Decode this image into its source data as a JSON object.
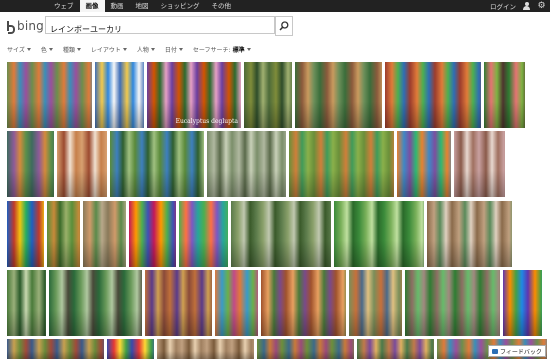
{
  "topnav": {
    "items": [
      "ウェブ",
      "画像",
      "動画",
      "地図",
      "ショッピング",
      "その他"
    ],
    "active_index": 1,
    "login": "ログイン"
  },
  "header": {
    "logo_text": "bing",
    "search_value": "レインボーユーカリ"
  },
  "filters": [
    {
      "label": "サイズ",
      "caret": true
    },
    {
      "label": "色",
      "caret": true
    },
    {
      "label": "種類",
      "caret": true
    },
    {
      "label": "レイアウト",
      "caret": true
    },
    {
      "label": "人物",
      "caret": true
    },
    {
      "label": "日付",
      "caret": true
    },
    {
      "label": "セーフサーチ:",
      "caret": false
    },
    {
      "label": "標準",
      "caret": true,
      "bold": true
    }
  ],
  "image_tiles": [
    {
      "name": "rainbow-eucalyptus-thumb-1",
      "colors": [
        "#6b8e4e",
        "#e07a3a",
        "#3a8fb7",
        "#9a4f9e"
      ]
    },
    {
      "name": "rainbow-eucalyptus-thumb-2",
      "colors": [
        "#3f6fb8",
        "#f2c94c",
        "#2e86de",
        "#f7f7f7"
      ]
    },
    {
      "name": "rainbow-eucalyptus-thumb-3",
      "colors": [
        "#6b3fa0",
        "#d35400",
        "#2c6b2f",
        "#e6a0c4"
      ],
      "caption": "Eucalyptus deglupta"
    },
    {
      "name": "rainbow-eucalyptus-thumb-4",
      "colors": [
        "#4d6b3a",
        "#7f8c3a",
        "#2e4d2a",
        "#a0b070"
      ]
    },
    {
      "name": "rainbow-eucalyptus-thumb-5",
      "colors": [
        "#3b6e3b",
        "#8b5a3c",
        "#c99a5e",
        "#6c8f5a"
      ]
    },
    {
      "name": "rainbow-eucalyptus-thumb-6",
      "colors": [
        "#9c3d2e",
        "#e07b39",
        "#4caf50",
        "#2f6db5"
      ]
    },
    {
      "name": "rainbow-eucalyptus-thumb-7",
      "colors": [
        "#2f7d32",
        "#e57373",
        "#7cb342",
        "#4e342e"
      ]
    },
    {
      "name": "rainbow-eucalyptus-thumb-8",
      "colors": [
        "#3e6b5e",
        "#8e5a99",
        "#d48a3c",
        "#5a8f4a"
      ]
    },
    {
      "name": "rainbow-eucalyptus-thumb-9",
      "colors": [
        "#d7a070",
        "#9b4a2f",
        "#f0e0d0",
        "#c67f4a"
      ]
    },
    {
      "name": "rainbow-eucalyptus-thumb-10",
      "colors": [
        "#5a8a3a",
        "#3d7fbf",
        "#2f5f2f",
        "#a0c080"
      ]
    },
    {
      "name": "rainbow-eucalyptus-thumb-11",
      "colors": [
        "#7b8e6a",
        "#b0b8a0",
        "#5a6a4a",
        "#c8d0b8"
      ]
    },
    {
      "name": "rainbow-eucalyptus-thumb-12",
      "colors": [
        "#6a8f3a",
        "#d07f3a",
        "#3f9a5a",
        "#8ab04a"
      ]
    },
    {
      "name": "rainbow-eucalyptus-thumb-13",
      "colors": [
        "#e8822f",
        "#3f88c5",
        "#7c4ea0",
        "#2eb872"
      ]
    },
    {
      "name": "rainbow-eucalyptus-thumb-14",
      "colors": [
        "#c8a0a0",
        "#8a5a4a",
        "#e8d8d0",
        "#a07060"
      ]
    },
    {
      "name": "rainbow-eucalyptus-thumb-15",
      "colors": [
        "#1f5fbf",
        "#c0392b",
        "#f1c40f",
        "#27ae60"
      ]
    },
    {
      "name": "rainbow-eucalyptus-thumb-16",
      "colors": [
        "#5a8f3a",
        "#c88a3a",
        "#3a6a2a",
        "#9ab06a"
      ]
    },
    {
      "name": "rainbow-eucalyptus-thumb-17",
      "colors": [
        "#8a7a5a",
        "#d09a6a",
        "#5a8a4a",
        "#b8a88a"
      ]
    },
    {
      "name": "rainbow-eucalyptus-thumb-18",
      "colors": [
        "#c2185b",
        "#ff9800",
        "#4caf50",
        "#3f51b5"
      ]
    },
    {
      "name": "rainbow-eucalyptus-thumb-19",
      "colors": [
        "#4caf50",
        "#ff7043",
        "#7e57c2",
        "#26a69a"
      ]
    },
    {
      "name": "rainbow-eucalyptus-thumb-20",
      "colors": [
        "#5a7a4a",
        "#8aa06a",
        "#c0c8b0",
        "#3a5a2a"
      ]
    },
    {
      "name": "rainbow-eucalyptus-thumb-21",
      "colors": [
        "#3a8a3a",
        "#7ab05a",
        "#c0e0a0",
        "#2a6a2a"
      ]
    },
    {
      "name": "rainbow-eucalyptus-thumb-22",
      "colors": [
        "#8a6a4a",
        "#c0a080",
        "#5a8a5a",
        "#e0d0c0"
      ]
    },
    {
      "name": "rainbow-eucalyptus-thumb-23",
      "colors": [
        "#4a7a3a",
        "#9ab07a",
        "#2a5a2a",
        "#c8d8b0"
      ]
    },
    {
      "name": "rainbow-eucalyptus-thumb-24",
      "colors": [
        "#2a6a3a",
        "#6a9a5a",
        "#b0c8a0",
        "#4a4a3a"
      ]
    },
    {
      "name": "rainbow-eucalyptus-thumb-25",
      "colors": [
        "#c0703a",
        "#5a3a8a",
        "#d0a050",
        "#8a4a3a"
      ]
    },
    {
      "name": "rainbow-eucalyptus-thumb-26",
      "colors": [
        "#e07a3a",
        "#3a9ac8",
        "#6ab04a",
        "#c04a8a"
      ]
    },
    {
      "name": "rainbow-eucalyptus-thumb-27",
      "colors": [
        "#a0522d",
        "#e8a060",
        "#4a7a3a",
        "#7a4a8a"
      ]
    },
    {
      "name": "rainbow-eucalyptus-thumb-28",
      "colors": [
        "#7a8f5a",
        "#c8703a",
        "#4a6a8a",
        "#e0c080"
      ]
    },
    {
      "name": "rainbow-eucalyptus-thumb-29",
      "colors": [
        "#2e7d32",
        "#8d6e63",
        "#66bb6a",
        "#a1887f"
      ]
    },
    {
      "name": "rainbow-eucalyptus-thumb-30",
      "colors": [
        "#5e35b1",
        "#fb8c00",
        "#43a047",
        "#1e88e5"
      ]
    },
    {
      "name": "rainbow-eucalyptus-thumb-31",
      "colors": [
        "#3a5a8a",
        "#c8a050",
        "#6a8a3a",
        "#a04a3a"
      ]
    },
    {
      "name": "rainbow-eucalyptus-thumb-32",
      "colors": [
        "#3949ab",
        "#e53935",
        "#fdd835",
        "#43a047"
      ]
    },
    {
      "name": "rainbow-eucalyptus-thumb-33",
      "colors": [
        "#c0a080",
        "#7a5a3a",
        "#e8d0b0",
        "#a08060"
      ]
    },
    {
      "name": "rainbow-eucalyptus-thumb-34",
      "colors": [
        "#6d8f3a",
        "#3a6a8a",
        "#c87a3a",
        "#9a4a7a"
      ]
    },
    {
      "name": "rainbow-eucalyptus-thumb-35",
      "colors": [
        "#4a7a4a",
        "#c07a4a",
        "#7a4a9a",
        "#e0b060"
      ]
    }
  ],
  "feedback": {
    "label": "フィードバック"
  }
}
